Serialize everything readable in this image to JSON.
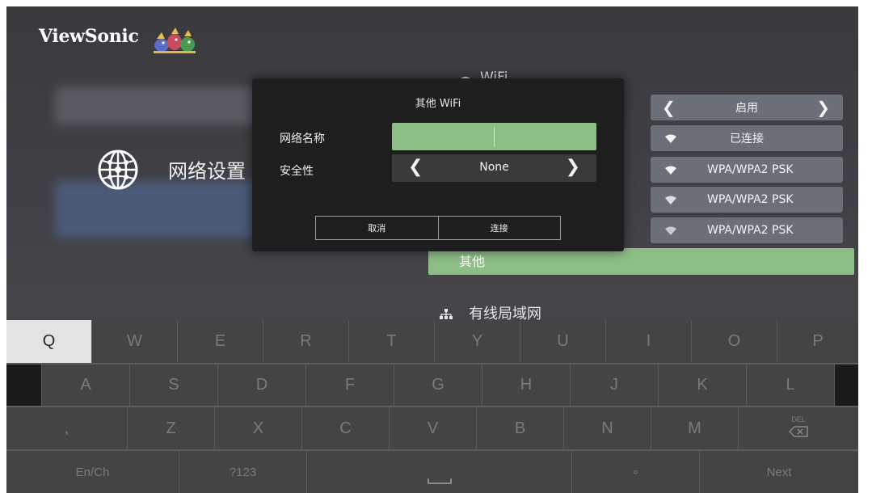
{
  "brand": {
    "name": "ViewSonic"
  },
  "menu": {
    "title": "网络设置"
  },
  "wifi_panel": {
    "header": "WiFi",
    "toggle_value": "启用",
    "status": "已连接",
    "networks": [
      "WPA/WPA2 PSK",
      "WPA/WPA2 PSK",
      "WPA/WPA2 PSK"
    ],
    "other_label": "其他",
    "wired_label": "有线局域网"
  },
  "dialog": {
    "title": "其他 WiFi",
    "network_name_label": "网络名称",
    "network_name_value": "",
    "security_label": "安全性",
    "security_value": "None",
    "cancel_label": "取消",
    "connect_label": "连接"
  },
  "keyboard": {
    "row1": [
      "Q",
      "W",
      "E",
      "R",
      "T",
      "Y",
      "U",
      "I",
      "O",
      "P"
    ],
    "row2": [
      "A",
      "S",
      "D",
      "F",
      "G",
      "H",
      "J",
      "K",
      "L"
    ],
    "row3": [
      ",",
      "Z",
      "X",
      "C",
      "V",
      "B",
      "N",
      "M"
    ],
    "lang_key": "En/Ch",
    "symbols_key": "?123",
    "dot_key": "∘",
    "next_key": "Next",
    "del_key": "DEL"
  },
  "colors": {
    "accent_green": "#8cbf86",
    "selected_key": "#e3e3e3",
    "dialog_bg": "#1e1e1e"
  }
}
